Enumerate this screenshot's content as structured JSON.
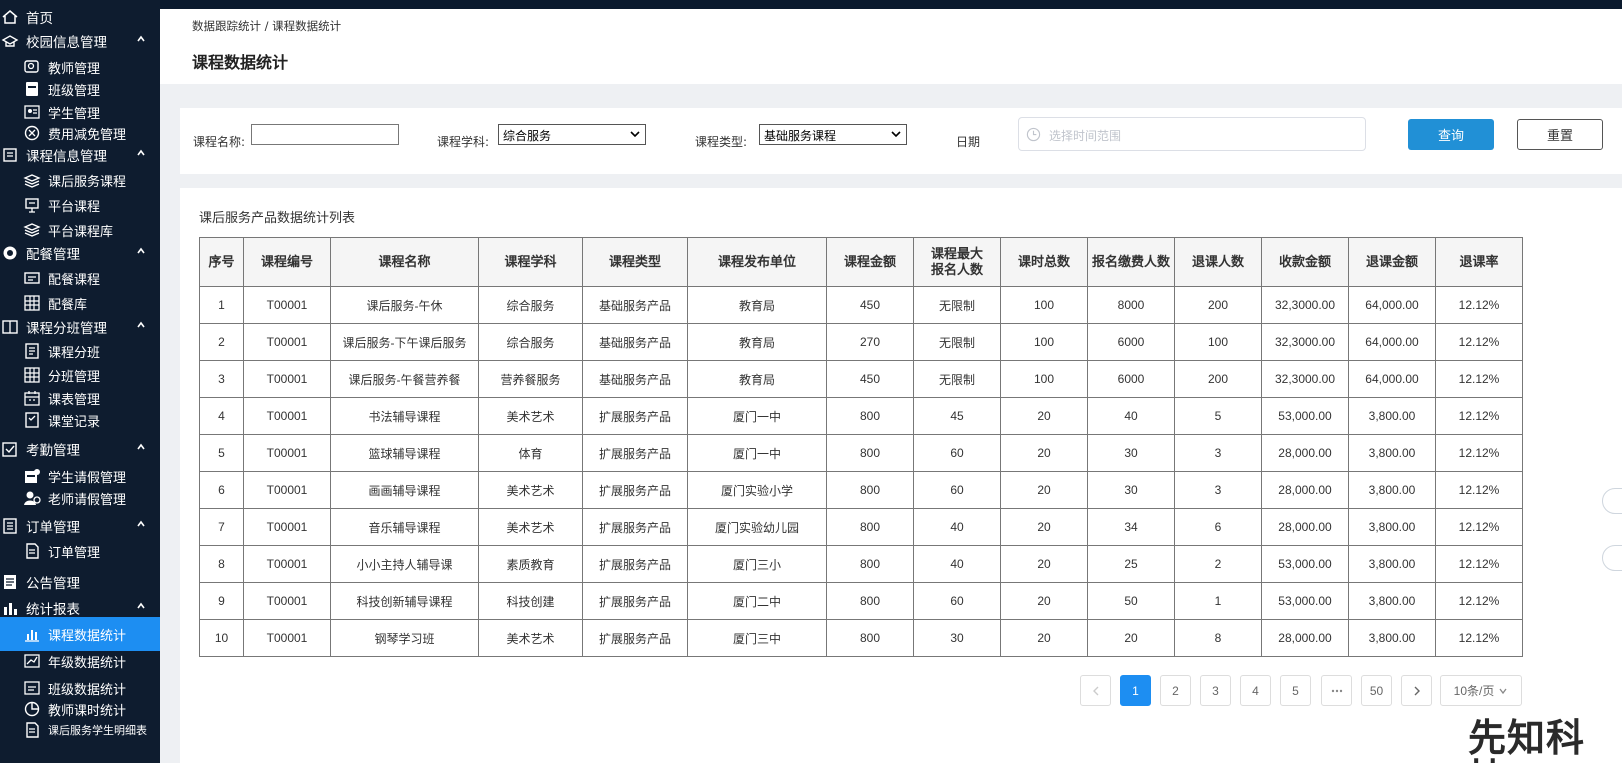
{
  "sidebar": {
    "items": [
      {
        "label": "首页",
        "type": "top",
        "icon": "home-icon"
      },
      {
        "label": "校园信息管理",
        "type": "group",
        "icon": "school-icon",
        "expanded": true
      },
      {
        "label": "教师管理",
        "type": "item",
        "icon": "teacher-icon"
      },
      {
        "label": "班级管理",
        "type": "item",
        "icon": "class-icon"
      },
      {
        "label": "学生管理",
        "type": "item",
        "icon": "student-icon"
      },
      {
        "label": "费用减免管理",
        "type": "item",
        "icon": "fee-icon"
      },
      {
        "label": "课程信息管理",
        "type": "group",
        "icon": "course-info-icon",
        "expanded": true
      },
      {
        "label": "课后服务课程",
        "type": "item",
        "icon": "layers-icon"
      },
      {
        "label": "平台课程",
        "type": "item",
        "icon": "platform-icon"
      },
      {
        "label": "平台课程库",
        "type": "item",
        "icon": "stack-icon"
      },
      {
        "label": "配餐管理",
        "type": "group",
        "icon": "meal-icon",
        "expanded": true
      },
      {
        "label": "配餐课程",
        "type": "item",
        "icon": "meal-course-icon"
      },
      {
        "label": "配餐库",
        "type": "item",
        "icon": "grid-icon"
      },
      {
        "label": "课程分班管理",
        "type": "group",
        "icon": "split-icon",
        "expanded": true
      },
      {
        "label": "课程分班",
        "type": "item",
        "icon": "course-split-icon"
      },
      {
        "label": "分班管理",
        "type": "item",
        "icon": "grid-icon"
      },
      {
        "label": "课表管理",
        "type": "item",
        "icon": "calendar-icon"
      },
      {
        "label": "课堂记录",
        "type": "item",
        "icon": "record-icon"
      },
      {
        "label": "考勤管理",
        "type": "group",
        "icon": "attendance-icon",
        "expanded": true
      },
      {
        "label": "学生请假管理",
        "type": "item",
        "icon": "student-leave-icon"
      },
      {
        "label": "老师请假管理",
        "type": "item",
        "icon": "teacher-leave-icon"
      },
      {
        "label": "订单管理",
        "type": "group",
        "icon": "order-icon",
        "expanded": true
      },
      {
        "label": "订单管理",
        "type": "item",
        "icon": "document-icon"
      },
      {
        "label": "公告管理",
        "type": "top",
        "icon": "notice-icon"
      },
      {
        "label": "统计报表",
        "type": "group",
        "icon": "report-icon",
        "expanded": true
      },
      {
        "label": "课程数据统计",
        "type": "item",
        "icon": "bar-chart-icon",
        "active": true
      },
      {
        "label": "年级数据统计",
        "type": "item",
        "icon": "line-chart-icon"
      },
      {
        "label": "班级数据统计",
        "type": "item",
        "icon": "class-stats-icon"
      },
      {
        "label": "教师课时统计",
        "type": "item",
        "icon": "pie-icon"
      },
      {
        "label": "课后服务学生明细表",
        "type": "item",
        "icon": "document-icon"
      }
    ]
  },
  "breadcrumb": "数据跟踪统计 / 课程数据统计",
  "page_title": "课程数据统计",
  "filter": {
    "course_name_label": "课程名称:",
    "course_name_value": "",
    "subject_label": "课程学科:",
    "subject_value": "综合服务",
    "type_label": "课程类型:",
    "type_value": "基础服务课程",
    "date_label": "日期",
    "date_placeholder": "选择时间范围",
    "query_label": "查询",
    "reset_label": "重置"
  },
  "list_title": "课后服务产品数据统计列表",
  "table": {
    "headers": [
      "序号",
      "课程编号",
      "课程名称",
      "课程学科",
      "课程类型",
      "课程发布单位",
      "课程金额",
      "课程最大\n报名人数",
      "课时总数",
      "报名缴费人数",
      "退课人数",
      "收款金额",
      "退课金额",
      "退课率"
    ],
    "rows": [
      [
        "1",
        "T00001",
        "课后服务-午休",
        "综合服务",
        "基础服务产品",
        "教育局",
        "450",
        "无限制",
        "100",
        "8000",
        "200",
        "32,3000.00",
        "64,000.00",
        "12.12%"
      ],
      [
        "2",
        "T00001",
        "课后服务-下午课后服务",
        "综合服务",
        "基础服务产品",
        "教育局",
        "270",
        "无限制",
        "100",
        "6000",
        "100",
        "32,3000.00",
        "64,000.00",
        "12.12%"
      ],
      [
        "3",
        "T00001",
        "课后服务-午餐营养餐",
        "营养餐服务",
        "基础服务产品",
        "教育局",
        "450",
        "无限制",
        "100",
        "6000",
        "200",
        "32,3000.00",
        "64,000.00",
        "12.12%"
      ],
      [
        "4",
        "T00001",
        "书法辅导课程",
        "美术艺术",
        "扩展服务产品",
        "厦门一中",
        "800",
        "45",
        "20",
        "40",
        "5",
        "53,000.00",
        "3,800.00",
        "12.12%"
      ],
      [
        "5",
        "T00001",
        "篮球辅导课程",
        "体育",
        "扩展服务产品",
        "厦门一中",
        "800",
        "60",
        "20",
        "30",
        "3",
        "28,000.00",
        "3,800.00",
        "12.12%"
      ],
      [
        "6",
        "T00001",
        "画画辅导课程",
        "美术艺术",
        "扩展服务产品",
        "厦门实验小学",
        "800",
        "60",
        "20",
        "30",
        "3",
        "28,000.00",
        "3,800.00",
        "12.12%"
      ],
      [
        "7",
        "T00001",
        "音乐辅导课程",
        "美术艺术",
        "扩展服务产品",
        "厦门实验幼儿园",
        "800",
        "40",
        "20",
        "34",
        "6",
        "28,000.00",
        "3,800.00",
        "12.12%"
      ],
      [
        "8",
        "T00001",
        "小小主持人辅导课",
        "素质教育",
        "扩展服务产品",
        "厦门三小",
        "800",
        "40",
        "20",
        "25",
        "2",
        "53,000.00",
        "3,800.00",
        "12.12%"
      ],
      [
        "9",
        "T00001",
        "科技创新辅导课程",
        "科技创建",
        "扩展服务产品",
        "厦门二中",
        "800",
        "60",
        "20",
        "50",
        "1",
        "53,000.00",
        "3,800.00",
        "12.12%"
      ],
      [
        "10",
        "T00001",
        "钢琴学习班",
        "美术艺术",
        "扩展服务产品",
        "厦门三中",
        "800",
        "30",
        "20",
        "20",
        "8",
        "28,000.00",
        "3,800.00",
        "12.12%"
      ]
    ]
  },
  "pagination": {
    "prev": "",
    "pages": [
      "1",
      "2",
      "3",
      "4",
      "5"
    ],
    "ellipsis": "",
    "last": "50",
    "next": "",
    "page_size": "10条/页",
    "current": "1"
  },
  "watermark": "先知科技"
}
